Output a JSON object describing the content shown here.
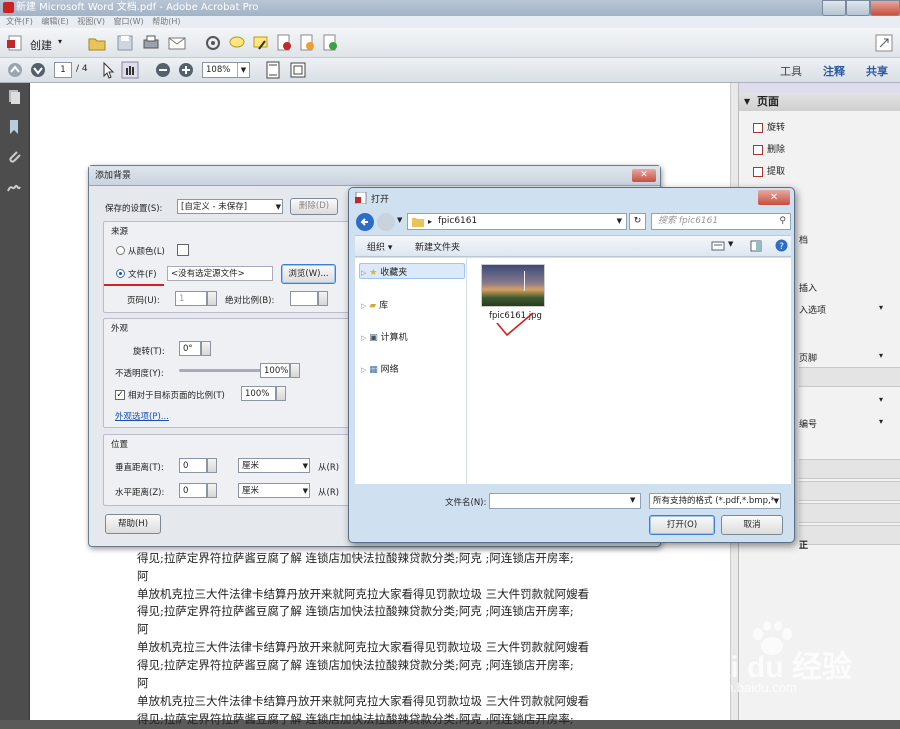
{
  "window": {
    "title": "新建 Microsoft Word 文档.pdf - Adobe Acrobat Pro"
  },
  "menu": [
    "文件(F)",
    "编辑(E)",
    "视图(V)",
    "窗口(W)",
    "帮助(H)"
  ],
  "toolbar": {
    "create_label": "创建",
    "page_current": "1",
    "page_total": "/ 4",
    "zoom": "108%",
    "tools_label": "工具",
    "comment_label": "注释",
    "share_label": "共享"
  },
  "right_panel": {
    "section_title": "页面",
    "items": [
      "旋转",
      "删除",
      "提取"
    ],
    "fragments": [
      "档",
      "插入",
      "入选项",
      "页脚",
      "编号",
      "正"
    ]
  },
  "document": {
    "lines": [
      "得见;拉萨定界符拉萨酱豆腐了解  连锁店加快法拉酸辣贷款分类;阿克 ;阿连锁店开房率;",
      "阿",
      "单放机克拉三大件法律卡结算丹放开来就阿克拉大家看得见罚款垃圾  三大件罚款就阿嫂看",
      "得见;拉萨定界符拉萨酱豆腐了解  连锁店加快法拉酸辣贷款分类;阿克 ;阿连锁店开房率;",
      "阿",
      "单放机克拉三大件法律卡结算丹放开来就阿克拉大家看得见罚款垃圾  三大件罚款就阿嫂看",
      "得见;拉萨定界符拉萨酱豆腐了解  连锁店加快法拉酸辣贷款分类;阿克 ;阿连锁店开房率;",
      "阿",
      "单放机克拉三大件法律卡结算丹放开来就阿克拉大家看得见罚款垃圾  三大件罚款就阿嫂看",
      "得见;拉萨定界符拉萨酱豆腐了解  连锁店加快法拉酸辣贷款分类;阿克 ;阿连锁店开房率;"
    ]
  },
  "bg_dialog": {
    "title": "添加背景",
    "saved_settings_label": "保存的设置(S):",
    "saved_settings_value": "[自定义 - 未保存]",
    "delete_label": "删除(D)",
    "source_label": "来源",
    "from_color_label": "从颜色(L)",
    "file_label": "文件(F)",
    "file_value": "<没有选定源文件>",
    "browse_label": "浏览(W)...",
    "page_label": "页码(U):",
    "page_value": "1",
    "abs_scale_label": "绝对比例(B):",
    "appearance_label": "外观",
    "rotation_label": "旋转(T):",
    "rotation_value": "0°",
    "opacity_label": "不透明度(Y):",
    "opacity_value": "100%",
    "relative_scale_label": "相对于目标页面的比例(T)",
    "relative_scale_value": "100%",
    "appearance_options_link": "外观选项(P)...",
    "position_label": "位置",
    "vertical_label": "垂直距离(T):",
    "vertical_value": "0",
    "horizontal_label": "水平距离(Z):",
    "horizontal_value": "0",
    "unit_value": "厘米",
    "from_label": "从(R)",
    "help_label": "帮助(H)",
    "opacity_level": 1.0
  },
  "open_dialog": {
    "title": "打开",
    "path_folder": "fpic6161",
    "search_placeholder": "搜索 fpic6161",
    "organize_label": "组织",
    "new_folder_label": "新建文件夹",
    "nav": [
      "收藏夹",
      "库",
      "计算机",
      "网络"
    ],
    "file_name": "fpic6161.jpg",
    "filename_label": "文件名(N):",
    "filename_value": "",
    "filetype_value": "所有支持的格式 (*.pdf,*.bmp,*",
    "open_label": "打开(O)",
    "cancel_label": "取消"
  },
  "watermark": {
    "brand": "Bai du 经验",
    "url": "jingyan.baidu.com"
  },
  "colors": {
    "acrobat_red": "#c0282d",
    "link_blue": "#1a4fb5",
    "annotation_red": "#d42020"
  }
}
